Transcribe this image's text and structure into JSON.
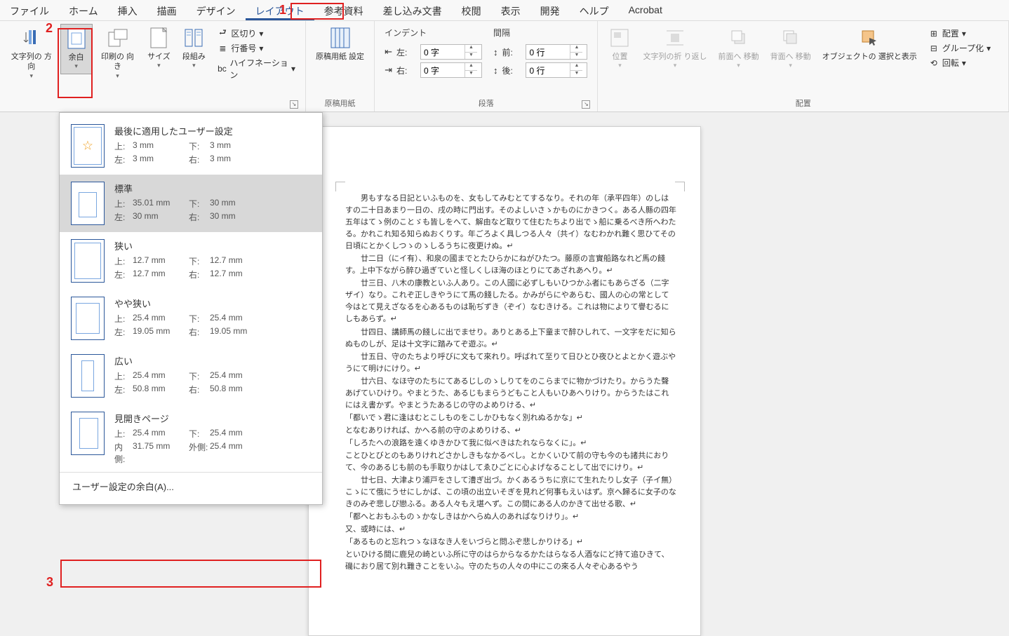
{
  "menu": {
    "tabs": [
      "ファイル",
      "ホーム",
      "挿入",
      "描画",
      "デザイン",
      "レイアウト",
      "参考資料",
      "差し込み文書",
      "校閲",
      "表示",
      "開発",
      "ヘルプ",
      "Acrobat"
    ],
    "active": 5
  },
  "ribbon": {
    "page_setup": {
      "text_dir": "文字列の\n方向",
      "margins": "余白",
      "orient": "印刷の\n向き",
      "size": "サイズ",
      "columns": "段組み",
      "breaks": "区切り",
      "line_no": "行番号",
      "hyphen": "ハイフネーション",
      "label": ""
    },
    "manuscript": {
      "btn": "原稿用紙\n設定",
      "label": "原稿用紙"
    },
    "paragraph": {
      "indent_hdr": "インデント",
      "spacing_hdr": "間隔",
      "left_lbl": "左:",
      "left_val": "0 字",
      "right_lbl": "右:",
      "right_val": "0 字",
      "before_lbl": "前:",
      "before_val": "0 行",
      "after_lbl": "後:",
      "after_val": "0 行",
      "label": "段落"
    },
    "arrange": {
      "position": "位置",
      "wrap": "文字列の折\nり返し",
      "front": "前面へ\n移動",
      "back": "背面へ\n移動",
      "select": "オブジェクトの\n選択と表示",
      "align": "配置",
      "group": "グループ化",
      "rotate": "回転",
      "label": "配置"
    }
  },
  "margins_menu": {
    "items": [
      {
        "name": "最後に適用したユーザー設定",
        "vals": {
          "上": "3 mm",
          "下": "3 mm",
          "左": "3 mm",
          "右": "3 mm"
        },
        "thumb": "user",
        "star": true
      },
      {
        "name": "標準",
        "vals": {
          "上": "35.01 mm",
          "下": "30 mm",
          "左": "30 mm",
          "右": "30 mm"
        },
        "thumb": "normal",
        "sel": true
      },
      {
        "name": "狭い",
        "vals": {
          "上": "12.7 mm",
          "下": "12.7 mm",
          "左": "12.7 mm",
          "右": "12.7 mm"
        },
        "thumb": "narrow"
      },
      {
        "name": "やや狭い",
        "vals": {
          "上": "25.4 mm",
          "下": "25.4 mm",
          "左": "19.05 mm",
          "右": "19.05 mm"
        },
        "thumb": "moderate"
      },
      {
        "name": "広い",
        "vals": {
          "上": "25.4 mm",
          "下": "25.4 mm",
          "左": "50.8 mm",
          "右": "50.8 mm"
        },
        "thumb": "wide"
      },
      {
        "name": "見開きページ",
        "vals": {
          "上": "25.4 mm",
          "下": "25.4 mm",
          "内側": "31.75 mm",
          "外側": "25.4 mm"
        },
        "thumb": "mirror"
      }
    ],
    "custom": "ユーザー設定の余白(A)..."
  },
  "document": {
    "paragraphs": [
      "　男もすなる日記といふものを、女もしてみむとてするなり。それの年（承平四年）のしはすの二十日あまり一日の、戌の時に門出す。そのよしいさゝかものにかきつく。ある人縣の四年五年はてゝ例のことゞも皆しをへて、解由など取りて住むたちより出でゝ船に乗るべき所へわたる。かれこれ知る知らぬおくりす。年ごろよく具しつる人々（共イ）なむわかれ難く思ひてその日頃にとかくしつゝのゝしるうちに夜更けぬ。↵",
      "　廿二日（にイ有）、和泉の國までとたひらかにねがひたつ。藤原の言實船路なれど馬の餞す。上中下ながら醉ひ過ぎていと怪しくしほ海のほとりにてあざれあへり。↵",
      "　廿三日、八木の康教といふ人あり。この人國に必ずしもいひつかふ者にもあらざる（二字ザイ）なり。これぞ正しきやうにて馬の餞したる。かみがらにやあらむ、國人の心の常として今はとて見えざなるを心あるものは恥ぢずき（ぞイ）なむきける。これは物によりて譽むるにしもあらず。↵",
      "　廿四日、講師馬の餞しに出でませり。ありとある上下童まで醉ひしれて、一文字をだに知らぬものしが、足は十文字に踏みてぞ遊ぶ。↵",
      "　廿五日、守のたちより呼びに文もて來れり。呼ばれて至りて日ひとひ夜ひとよとかく遊ぶやうにて明けにけり。↵",
      "　廿六日、なほ守のたちにてあるじしのゝしりてをのこらまでに物かづけたり。からうた聲あげていひけり。やまとうた、あるじもまらうどもこと人もいひあへりけり。からうたはこれにはえ書かず。やまとうたあるじの守のよめりける、↵",
      "「都いでゝ君に逢はむとこしものをこしかひもなく別れぬるかな」↵",
      "となむありければ、かへる前の守のよめりける、↵",
      "「しろたへの浪路を遠くゆきかひて我に似べきはたれならなくに」。↵",
      "ことひとびとのもありけれどさかしきもなかるべし。とかくいひて前の守も今のも諸共におりて、今のあるじも前のも手取りかはしてゑひごとに心よげなることして出でにけり。↵",
      "　廿七日、大津より浦戸をさして漕ぎ出づ。かくあるうちに京にて生れたりし女子（子イ無）こゝにて俄にうせにしかば、この頃の出立いそぎを見れど何事もえいはず。京へ歸るに女子のなきのみぞ悲しび戀ふる。ある人々もえ堪へず。この間にある人のかきて出せる歌、↵",
      "「都へとおもふものゝかなしきはかへらぬ人のあればなりけり」。↵",
      "又、或時には、↵",
      "「あるものと忘れつゝなほなき人をいづらと問ふぞ悲しかりける」↵",
      "といひける間に鹿兒の崎といふ所に守のはらからなるかたはらなる人酒なにど持て追ひきて、磯におり居て別れ難きことをいふ。守のたちの人々の中にこの來る人々ぞ心あるやう"
    ]
  },
  "callouts": {
    "c1": "1",
    "c2": "2",
    "c3": "3"
  }
}
